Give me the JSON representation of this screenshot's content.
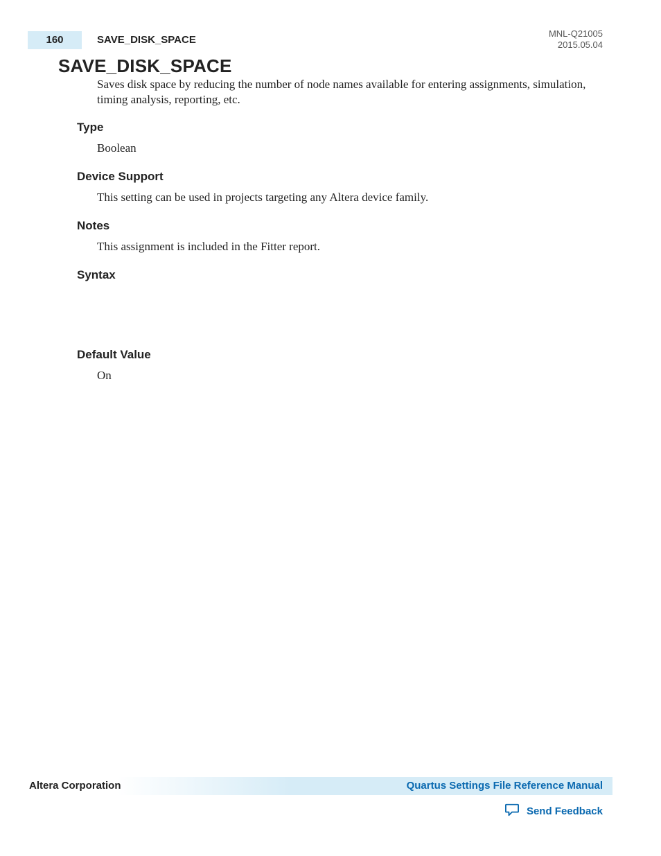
{
  "header": {
    "page_number": "160",
    "running_title": "SAVE_DISK_SPACE",
    "doc_id": "MNL-Q21005",
    "doc_date": "2015.05.04"
  },
  "title": "SAVE_DISK_SPACE",
  "intro": "Saves disk space by reducing the number of node names available for entering assignments, simulation, timing analysis, reporting, etc.",
  "sections": {
    "type": {
      "heading": "Type",
      "body": "Boolean"
    },
    "device_support": {
      "heading": "Device Support",
      "body": "This setting can be used in projects targeting any Altera device family."
    },
    "notes": {
      "heading": "Notes",
      "body": "This assignment is included in the Fitter report."
    },
    "syntax": {
      "heading": "Syntax",
      "body": ""
    },
    "default_value": {
      "heading": "Default Value",
      "body": "On"
    }
  },
  "footer": {
    "corporation": "Altera Corporation",
    "manual_link": "Quartus Settings File Reference Manual",
    "feedback_label": "Send Feedback"
  },
  "colors": {
    "band": "#d6ecf7",
    "link": "#0a69b0"
  }
}
